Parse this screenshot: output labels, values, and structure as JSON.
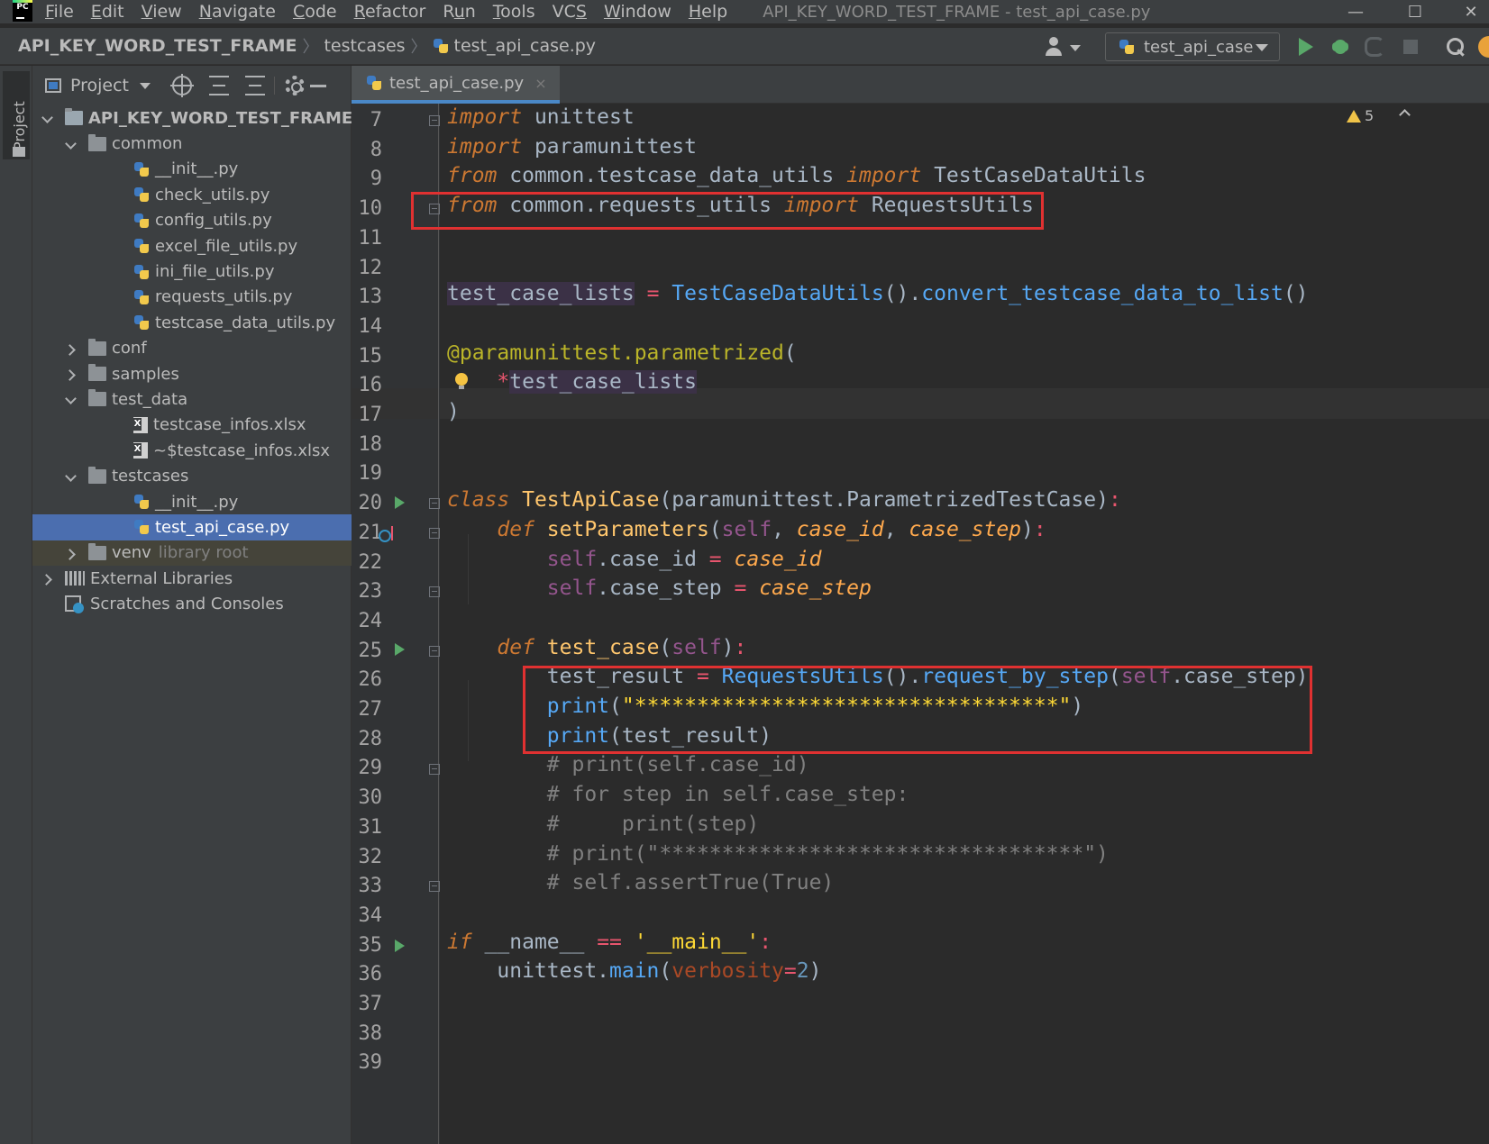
{
  "app": {
    "logo_text": "PC",
    "window_title": "API_KEY_WORD_TEST_FRAME - test_api_case.py"
  },
  "menu": [
    {
      "label": "File",
      "mnemonic": "F"
    },
    {
      "label": "Edit",
      "mnemonic": "E"
    },
    {
      "label": "View",
      "mnemonic": "V"
    },
    {
      "label": "Navigate",
      "mnemonic": "N"
    },
    {
      "label": "Code",
      "mnemonic": "C"
    },
    {
      "label": "Refactor",
      "mnemonic": "R"
    },
    {
      "label": "Run",
      "mnemonic": "u"
    },
    {
      "label": "Tools",
      "mnemonic": "T"
    },
    {
      "label": "VCS",
      "mnemonic": "S"
    },
    {
      "label": "Window",
      "mnemonic": "W"
    },
    {
      "label": "Help",
      "mnemonic": "H"
    }
  ],
  "window_controls": {
    "minimize": "—",
    "maximize": "☐",
    "close": "✕"
  },
  "breadcrumb": [
    "API_KEY_WORD_TEST_FRAME",
    "testcases",
    "test_api_case.py"
  ],
  "toolbar": {
    "run_config": "test_api_case",
    "icons": [
      "user-icon",
      "run-icon",
      "debug-icon",
      "coverage-icon",
      "stop-icon",
      "search-icon",
      "update-icon"
    ]
  },
  "tool_strip": {
    "project_label": "Project"
  },
  "project_panel": {
    "title": "Project",
    "tree": [
      {
        "label": "API_KEY_WORD_TEST_FRAME",
        "extra": "E",
        "type": "root",
        "arrow": "down",
        "level": 0
      },
      {
        "label": "common",
        "type": "folder",
        "arrow": "down",
        "level": 1
      },
      {
        "label": "__init__.py",
        "type": "py",
        "level": 2
      },
      {
        "label": "check_utils.py",
        "type": "py",
        "level": 2
      },
      {
        "label": "config_utils.py",
        "type": "py",
        "level": 2
      },
      {
        "label": "excel_file_utils.py",
        "type": "py",
        "level": 2
      },
      {
        "label": "ini_file_utils.py",
        "type": "py",
        "level": 2
      },
      {
        "label": "requests_utils.py",
        "type": "py",
        "level": 2
      },
      {
        "label": "testcase_data_utils.py",
        "type": "py",
        "level": 2
      },
      {
        "label": "conf",
        "type": "folder",
        "arrow": "right",
        "level": 1
      },
      {
        "label": "samples",
        "type": "folder",
        "arrow": "right",
        "level": 1
      },
      {
        "label": "test_data",
        "type": "folder",
        "arrow": "down",
        "level": 1
      },
      {
        "label": "testcase_infos.xlsx",
        "type": "xls",
        "level": 2
      },
      {
        "label": "~$testcase_infos.xlsx",
        "type": "xls",
        "level": 2
      },
      {
        "label": "testcases",
        "type": "folder",
        "arrow": "down",
        "level": 1
      },
      {
        "label": "__init__.py",
        "type": "py",
        "level": 2
      },
      {
        "label": "test_api_case.py",
        "type": "py",
        "level": 2,
        "selected": true
      },
      {
        "label": "venv",
        "extra": "library root",
        "type": "folder",
        "arrow": "right",
        "level": 1,
        "venv": true
      },
      {
        "label": "External Libraries",
        "type": "lib",
        "arrow": "right",
        "level": 0
      },
      {
        "label": "Scratches and Consoles",
        "type": "scratch",
        "level": 0
      }
    ]
  },
  "editor": {
    "tab_label": "test_api_case.py",
    "tab_close": "×",
    "warnings_count": "5",
    "current_line": 16,
    "lines": [
      {
        "n": "7",
        "tokens": [
          [
            "kw",
            "import"
          ],
          [
            "cls",
            " unittest"
          ]
        ]
      },
      {
        "n": "8",
        "tokens": [
          [
            "kw",
            "import"
          ],
          [
            "cls",
            " paramunittest"
          ]
        ]
      },
      {
        "n": "9",
        "tokens": [
          [
            "kw",
            "from"
          ],
          [
            "cls",
            " common.testcase_data_utils "
          ],
          [
            "kw",
            "import"
          ],
          [
            "cls",
            " TestCaseDataUtils"
          ]
        ]
      },
      {
        "n": "10",
        "tokens": [
          [
            "kw",
            "from"
          ],
          [
            "cls",
            " common.requests_utils "
          ],
          [
            "kw",
            "import"
          ],
          [
            "cls",
            " RequestsUtils"
          ]
        ]
      },
      {
        "n": "11",
        "tokens": []
      },
      {
        "n": "12",
        "tokens": []
      },
      {
        "n": "13",
        "tokens": [
          [
            "hl-var",
            "test_case_lists"
          ],
          [
            "cls",
            " "
          ],
          [
            "redop",
            "="
          ],
          [
            "cls",
            " "
          ],
          [
            "fncall",
            "TestCaseDataUtils"
          ],
          [
            "cls",
            "()."
          ],
          [
            "fncall",
            "convert_testcase_data_to_list"
          ],
          [
            "cls",
            "()"
          ]
        ]
      },
      {
        "n": "14",
        "tokens": []
      },
      {
        "n": "15",
        "tokens": [
          [
            "dec",
            "@paramunittest.parametrized"
          ],
          [
            "cls",
            "("
          ]
        ]
      },
      {
        "n": "16",
        "tokens": [
          [
            "cls",
            "    "
          ],
          [
            "redop",
            "*"
          ],
          [
            "hl-var",
            "test_case_lists"
          ]
        ]
      },
      {
        "n": "17",
        "tokens": [
          [
            "cls",
            ")"
          ]
        ]
      },
      {
        "n": "18",
        "tokens": []
      },
      {
        "n": "19",
        "tokens": []
      },
      {
        "n": "20",
        "tokens": [
          [
            "kw",
            "class"
          ],
          [
            "cls",
            " "
          ],
          [
            "fn",
            "TestApiCase"
          ],
          [
            "cls",
            "(paramunittest.ParametrizedTestCase)"
          ],
          [
            "redop",
            ":"
          ]
        ]
      },
      {
        "n": "21",
        "tokens": [
          [
            "cls",
            "    "
          ],
          [
            "kw",
            "def"
          ],
          [
            "cls",
            " "
          ],
          [
            "fn",
            "setParameters"
          ],
          [
            "cls",
            "("
          ],
          [
            "selfc",
            "self"
          ],
          [
            "cls",
            ", "
          ],
          [
            "param",
            "case_id"
          ],
          [
            "cls",
            ", "
          ],
          [
            "param",
            "case_step"
          ],
          [
            "cls",
            ")"
          ],
          [
            "redop",
            ":"
          ]
        ]
      },
      {
        "n": "22",
        "tokens": [
          [
            "cls",
            "        "
          ],
          [
            "selfc",
            "self"
          ],
          [
            "cls",
            ".case_id "
          ],
          [
            "redop",
            "="
          ],
          [
            "cls",
            " "
          ],
          [
            "param",
            "case_id"
          ]
        ]
      },
      {
        "n": "23",
        "tokens": [
          [
            "cls",
            "        "
          ],
          [
            "selfc",
            "self"
          ],
          [
            "cls",
            ".case_step "
          ],
          [
            "redop",
            "="
          ],
          [
            "cls",
            " "
          ],
          [
            "param",
            "case_step"
          ]
        ]
      },
      {
        "n": "24",
        "tokens": []
      },
      {
        "n": "25",
        "tokens": [
          [
            "cls",
            "    "
          ],
          [
            "kw",
            "def"
          ],
          [
            "cls",
            " "
          ],
          [
            "fn",
            "test_case"
          ],
          [
            "cls",
            "("
          ],
          [
            "selfc",
            "self"
          ],
          [
            "cls",
            ")"
          ],
          [
            "redop",
            ":"
          ]
        ]
      },
      {
        "n": "26",
        "tokens": [
          [
            "cls",
            "        test_result "
          ],
          [
            "redop",
            "="
          ],
          [
            "cls",
            " "
          ],
          [
            "fncall",
            "RequestsUtils"
          ],
          [
            "cls",
            "()."
          ],
          [
            "fncall",
            "request_by_step"
          ],
          [
            "cls",
            "("
          ],
          [
            "selfc",
            "self"
          ],
          [
            "cls",
            ".case_step)"
          ]
        ]
      },
      {
        "n": "27",
        "tokens": [
          [
            "cls",
            "        "
          ],
          [
            "fncall",
            "print"
          ],
          [
            "cls",
            "("
          ],
          [
            "strbg",
            "\"**********************************\""
          ],
          [
            "cls",
            ")"
          ]
        ]
      },
      {
        "n": "28",
        "tokens": [
          [
            "cls",
            "        "
          ],
          [
            "fncall",
            "print"
          ],
          [
            "cls",
            "(test_result)"
          ]
        ]
      },
      {
        "n": "29",
        "tokens": [
          [
            "com",
            "        # print(self.case_id)"
          ]
        ]
      },
      {
        "n": "30",
        "tokens": [
          [
            "com",
            "        # for step in self.case_step:"
          ]
        ]
      },
      {
        "n": "31",
        "tokens": [
          [
            "com",
            "        #     print(step)"
          ]
        ]
      },
      {
        "n": "32",
        "tokens": [
          [
            "com",
            "        # print(\"**********************************\")"
          ]
        ]
      },
      {
        "n": "33",
        "tokens": [
          [
            "com",
            "        # self.assertTrue(True)"
          ]
        ]
      },
      {
        "n": "34",
        "tokens": []
      },
      {
        "n": "35",
        "tokens": [
          [
            "kw",
            "if"
          ],
          [
            "cls",
            " __name__ "
          ],
          [
            "redop",
            "=="
          ],
          [
            "cls",
            " "
          ],
          [
            "strbg",
            "'__main__'"
          ],
          [
            "redop",
            ":"
          ]
        ]
      },
      {
        "n": "36",
        "tokens": [
          [
            "cls",
            "    unittest."
          ],
          [
            "fncall",
            "main"
          ],
          [
            "cls",
            "("
          ],
          [
            "param-plain",
            "verbosity"
          ],
          [
            "redop",
            "="
          ],
          [
            "num",
            "2"
          ],
          [
            "cls",
            ")"
          ]
        ]
      },
      {
        "n": "37",
        "tokens": []
      },
      {
        "n": "38",
        "tokens": []
      },
      {
        "n": "39",
        "tokens": []
      }
    ]
  }
}
